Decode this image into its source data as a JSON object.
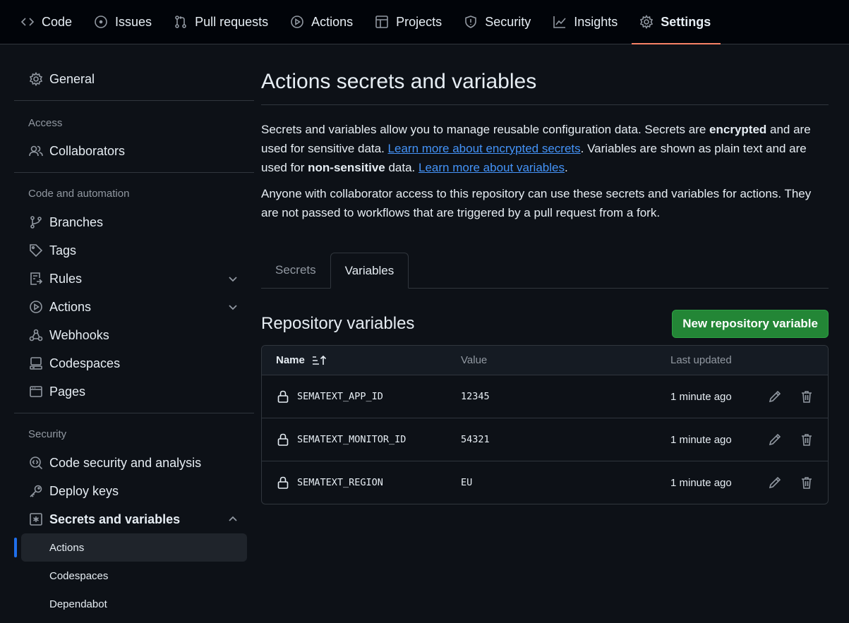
{
  "nav": {
    "tabs": [
      {
        "label": "Code",
        "icon": "code-icon"
      },
      {
        "label": "Issues",
        "icon": "issue-icon"
      },
      {
        "label": "Pull requests",
        "icon": "pull-request-icon"
      },
      {
        "label": "Actions",
        "icon": "play-icon"
      },
      {
        "label": "Projects",
        "icon": "table-icon"
      },
      {
        "label": "Security",
        "icon": "shield-icon"
      },
      {
        "label": "Insights",
        "icon": "graph-icon"
      },
      {
        "label": "Settings",
        "icon": "gear-icon"
      }
    ],
    "active": "Settings"
  },
  "sidebar": {
    "general": "General",
    "access_heading": "Access",
    "collaborators": "Collaborators",
    "code_heading": "Code and automation",
    "branches": "Branches",
    "tags": "Tags",
    "rules": "Rules",
    "actions": "Actions",
    "webhooks": "Webhooks",
    "codespaces": "Codespaces",
    "pages": "Pages",
    "security_heading": "Security",
    "code_security": "Code security and analysis",
    "deploy_keys": "Deploy keys",
    "secrets": "Secrets and variables",
    "sub": {
      "actions": "Actions",
      "codespaces": "Codespaces",
      "dependabot": "Dependabot"
    }
  },
  "main": {
    "title": "Actions secrets and variables",
    "p1_a": "Secrets and variables allow you to manage reusable configuration data. Secrets are ",
    "p1_b": "encrypted",
    "p1_c": " and are used for sensitive data. ",
    "p1_link1": "Learn more about encrypted secrets",
    "p1_d": ". Variables are shown as plain text and are used for ",
    "p1_e": "non-sensitive",
    "p1_f": " data. ",
    "p1_link2": "Learn more about variables",
    "p1_g": ".",
    "p2": "Anyone with collaborator access to this repository can use these secrets and variables for actions. They are not passed to workflows that are triggered by a pull request from a fork.",
    "tabs": [
      "Secrets",
      "Variables"
    ],
    "active_tab": "Variables",
    "repo_title": "Repository variables",
    "new_button": "New repository variable",
    "table": {
      "headers": {
        "name": "Name",
        "value": "Value",
        "updated": "Last updated"
      },
      "rows": [
        {
          "name": "SEMATEXT_APP_ID",
          "value": "12345",
          "updated": "1 minute ago"
        },
        {
          "name": "SEMATEXT_MONITOR_ID",
          "value": "54321",
          "updated": "1 minute ago"
        },
        {
          "name": "SEMATEXT_REGION",
          "value": "EU",
          "updated": "1 minute ago"
        }
      ]
    }
  },
  "colors": {
    "background": "#0d1117",
    "accent_underline": "#f78166",
    "link": "#4493f8",
    "primary_button": "#238636",
    "selection_bar": "#1f6feb"
  }
}
